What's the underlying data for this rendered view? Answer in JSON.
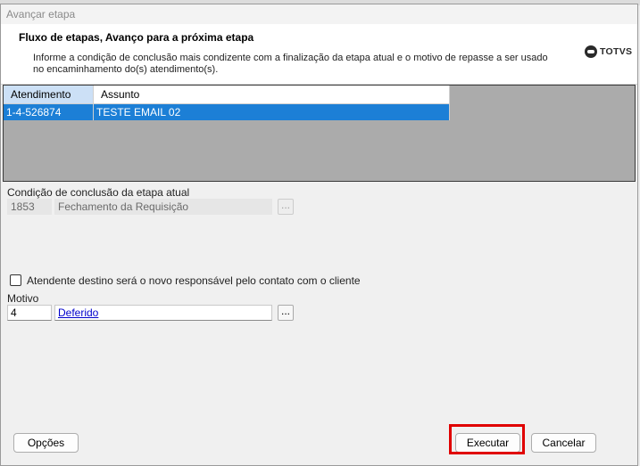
{
  "window": {
    "title": "Avançar etapa"
  },
  "header": {
    "title": "Fluxo de etapas, Avanço para a próxima etapa",
    "description": "Informe a condição de conclusão mais condizente com a finalização da etapa atual e o motivo de repasse a ser usado no encaminhamento do(s) atendimento(s).",
    "logo_text": "TOTVS"
  },
  "grid": {
    "columns": [
      "Atendimento",
      "Assunto"
    ],
    "rows": [
      {
        "atendimento": "1-4-526874",
        "assunto": "TESTE EMAIL 02"
      }
    ]
  },
  "condicao": {
    "label": "Condição de conclusão da etapa atual",
    "code": "1853",
    "description": "Fechamento da Requisição",
    "button": "..."
  },
  "checkbox": {
    "label": "Atendente destino será o novo responsável pelo contato com o cliente",
    "checked": false
  },
  "motivo": {
    "label": "Motivo",
    "code": "4",
    "description": "Deferido",
    "button": "..."
  },
  "buttons": {
    "opcoes": "Opções",
    "executar": "Executar",
    "cancelar": "Cancelar"
  }
}
